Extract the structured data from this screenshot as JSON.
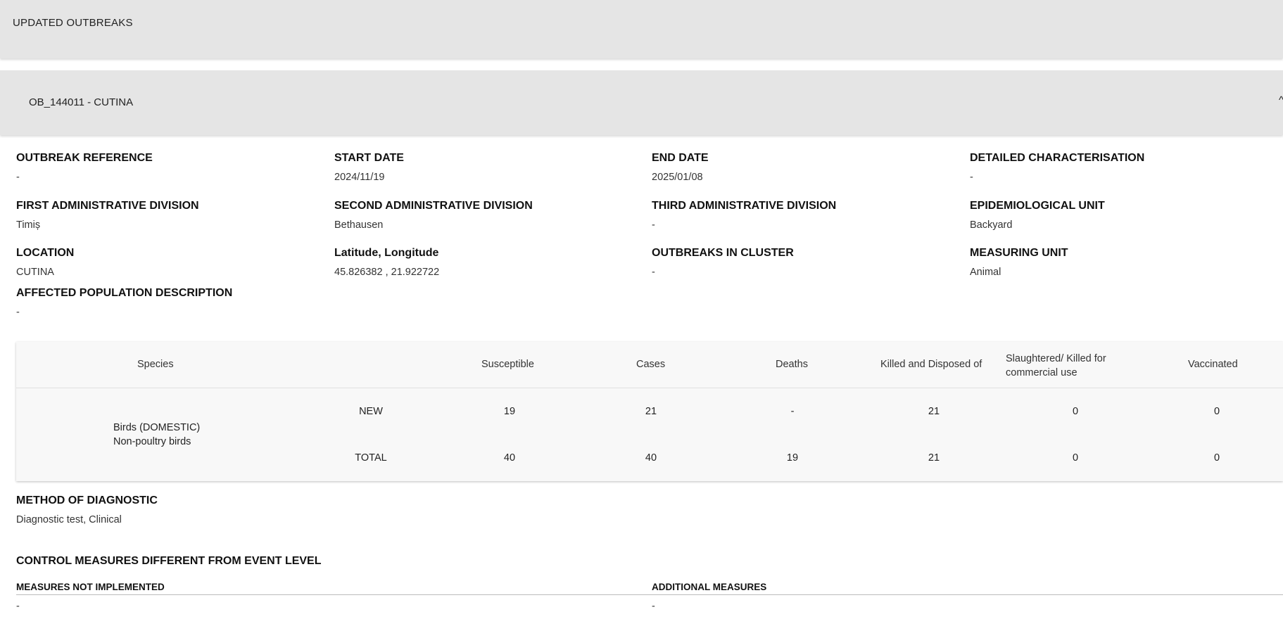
{
  "header": {
    "title": "UPDATED OUTBREAKS"
  },
  "outbreak": {
    "title": "OB_144011 - CUTINA",
    "toggle": "^"
  },
  "fields": {
    "outbreak_reference": {
      "label": "OUTBREAK REFERENCE",
      "value": "-"
    },
    "start_date": {
      "label": "START DATE",
      "value": "2024/11/19"
    },
    "end_date": {
      "label": "END DATE",
      "value": "2025/01/08"
    },
    "detailed_characterisation": {
      "label": "DETAILED CHARACTERISATION",
      "value": "-"
    },
    "first_admin": {
      "label": "FIRST ADMINISTRATIVE DIVISION",
      "value": "Timiș"
    },
    "second_admin": {
      "label": "SECOND ADMINISTRATIVE DIVISION",
      "value": "Bethausen"
    },
    "third_admin": {
      "label": "THIRD ADMINISTRATIVE DIVISION",
      "value": "-"
    },
    "epi_unit": {
      "label": "EPIDEMIOLOGICAL UNIT",
      "value": "Backyard"
    },
    "location": {
      "label": "LOCATION",
      "value": "CUTINA"
    },
    "lat_long": {
      "label": "Latitude, Longitude",
      "value": "45.826382 , 21.922722"
    },
    "outbreaks_cluster": {
      "label": "OUTBREAKS IN CLUSTER",
      "value": "-"
    },
    "measuring_unit": {
      "label": "MEASURING UNIT",
      "value": "Animal"
    },
    "affected_population": {
      "label": "AFFECTED POPULATION DESCRIPTION",
      "value": "-"
    }
  },
  "table": {
    "headers": {
      "species": "Species",
      "susceptible": "Susceptible",
      "cases": "Cases",
      "deaths": "Deaths",
      "killed": "Killed and Disposed of",
      "slaughtered_1": "Slaughtered/ Killed for",
      "slaughtered_2": "commercial use",
      "vaccinated": "Vaccinated"
    },
    "species_line1": "Birds (DOMESTIC)",
    "species_line2": "Non-poultry birds",
    "rows": [
      {
        "type": "NEW",
        "susceptible": "19",
        "cases": "21",
        "deaths": "-",
        "killed": "21",
        "slaughtered": "0",
        "vaccinated": "0"
      },
      {
        "type": "TOTAL",
        "susceptible": "40",
        "cases": "40",
        "deaths": "19",
        "killed": "21",
        "slaughtered": "0",
        "vaccinated": "0"
      }
    ]
  },
  "diagnostic": {
    "label": "METHOD OF DIAGNOSTIC",
    "value": "Diagnostic test, Clinical"
  },
  "control": {
    "title": "CONTROL MEASURES DIFFERENT FROM EVENT LEVEL",
    "not_implemented_label": "MEASURES NOT IMPLEMENTED",
    "not_implemented_value": "-",
    "additional_label": "ADDITIONAL MEASURES",
    "additional_value": "-"
  }
}
